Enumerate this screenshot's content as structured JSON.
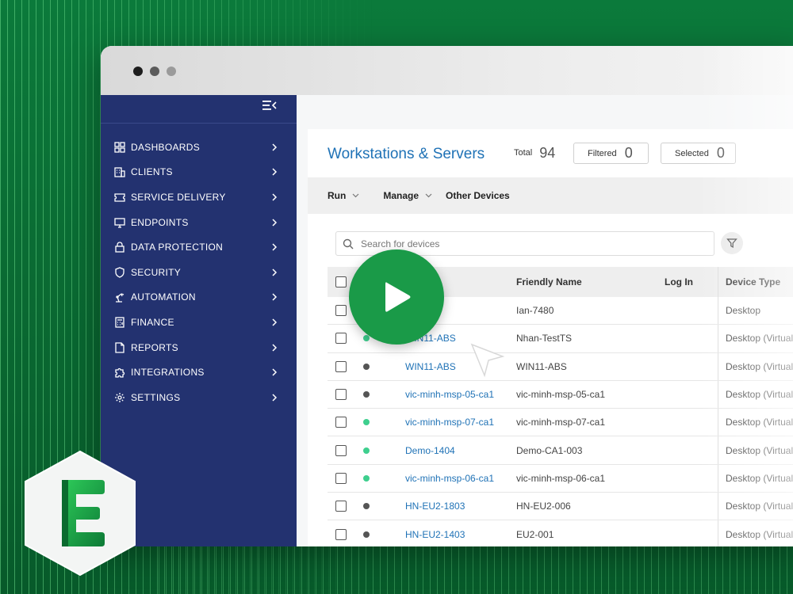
{
  "sidebar": {
    "items": [
      {
        "label": "DASHBOARDS",
        "icon": "dashboard-icon"
      },
      {
        "label": "CLIENTS",
        "icon": "building-icon"
      },
      {
        "label": "SERVICE DELIVERY",
        "icon": "ticket-icon"
      },
      {
        "label": "ENDPOINTS",
        "icon": "monitor-icon"
      },
      {
        "label": "DATA PROTECTION",
        "icon": "lock-icon"
      },
      {
        "label": "SECURITY",
        "icon": "shield-icon"
      },
      {
        "label": "AUTOMATION",
        "icon": "robot-arm-icon"
      },
      {
        "label": "FINANCE",
        "icon": "calculator-icon"
      },
      {
        "label": "REPORTS",
        "icon": "report-icon"
      },
      {
        "label": "INTEGRATIONS",
        "icon": "puzzle-icon"
      },
      {
        "label": "SETTINGS",
        "icon": "gear-icon"
      }
    ]
  },
  "header": {
    "title": "Workstations & Servers",
    "total_label": "Total",
    "total_value": "94",
    "filtered_label": "Filtered",
    "filtered_value": "0",
    "selected_label": "Selected",
    "selected_value": "0"
  },
  "toolbar": {
    "run_label": "Run",
    "manage_label": "Manage",
    "other_label": "Other Devices"
  },
  "search": {
    "placeholder": "Search for devices"
  },
  "table": {
    "columns": [
      "Friendly Name",
      "Log In",
      "Device Type"
    ],
    "rows": [
      {
        "name": "",
        "friendly": "Ian-7480",
        "type": "Desktop",
        "status": "none"
      },
      {
        "name": "WIN11-ABS",
        "friendly": "Nhan-TestTS",
        "type": "Desktop (Virtual)",
        "status": "online"
      },
      {
        "name": "WIN11-ABS",
        "friendly": "WIN11-ABS",
        "type": "Desktop (Virtual)",
        "status": "offline"
      },
      {
        "name": "vic-minh-msp-05-ca1",
        "friendly": "vic-minh-msp-05-ca1",
        "type": "Desktop (Virtual)",
        "status": "offline"
      },
      {
        "name": "vic-minh-msp-07-ca1",
        "friendly": "vic-minh-msp-07-ca1",
        "type": "Desktop (Virtual)",
        "status": "online"
      },
      {
        "name": "Demo-1404",
        "friendly": "Demo-CA1-003",
        "type": "Desktop (Virtual)",
        "status": "online"
      },
      {
        "name": "vic-minh-msp-06-ca1",
        "friendly": "vic-minh-msp-06-ca1",
        "type": "Desktop (Virtual)",
        "status": "online"
      },
      {
        "name": "HN-EU2-1803",
        "friendly": "HN-EU2-006",
        "type": "Desktop (Virtual)",
        "status": "offline"
      },
      {
        "name": "HN-EU2-1403",
        "friendly": "EU2-001",
        "type": "Desktop (Virtual)",
        "status": "offline"
      }
    ]
  },
  "colors": {
    "sidebar_bg": "#233270",
    "accent_blue": "#1f72b6",
    "online": "#3ecf8e",
    "offline": "#555555",
    "play_button": "#1a9a48",
    "background": "#0b7a3b"
  },
  "overlay": {
    "play_icon": "play-icon",
    "cursor_icon": "cursor-icon",
    "logo_icon": "logo-e-icon"
  }
}
